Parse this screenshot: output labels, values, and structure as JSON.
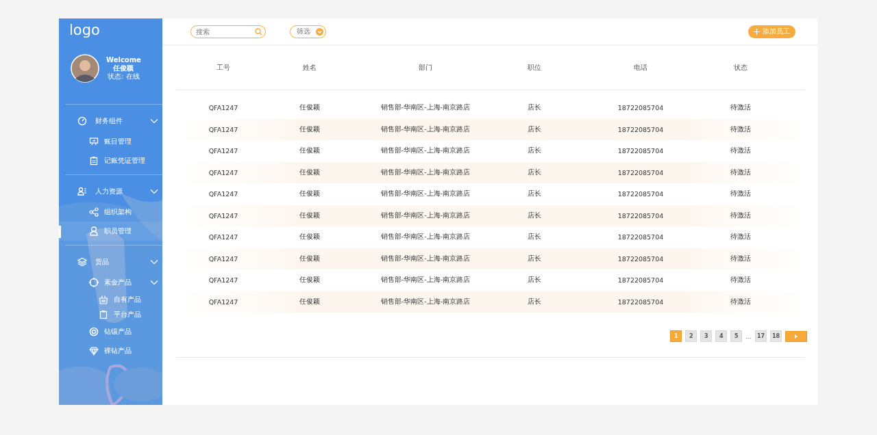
{
  "sidebar": {
    "logo": "logo",
    "profile": {
      "greeting": "Welcome",
      "name": "任俊颖",
      "status": "状态: 在线"
    },
    "groups": [
      {
        "label": "财务组件",
        "expanded": true,
        "children": [
          {
            "label": "账目管理",
            "selected": false
          },
          {
            "label": "记账凭证管理",
            "selected": false
          }
        ]
      },
      {
        "label": "人力资源",
        "expanded": true,
        "children": [
          {
            "label": "组织架构",
            "selected": false
          },
          {
            "label": "职员管理",
            "selected": true
          }
        ]
      },
      {
        "label": "货品",
        "expanded": true,
        "children": [
          {
            "label": "素金产品",
            "selected": false,
            "expanded": true,
            "children": [
              {
                "label": "自有产品",
                "selected": false
              },
              {
                "label": "平台产品",
                "selected": false
              }
            ]
          },
          {
            "label": "钻镶产品",
            "selected": false
          },
          {
            "label": "裸钻产品",
            "selected": false
          }
        ]
      }
    ]
  },
  "toolbar": {
    "search": {
      "placeholder": "搜索"
    },
    "filter": {
      "label": "筛选"
    },
    "add_button": {
      "label": "添加员工"
    }
  },
  "table": {
    "columns": [
      "工号",
      "姓名",
      "部门",
      "职位",
      "电话",
      "状态"
    ],
    "rows": [
      [
        "QFA1247",
        "任俊颖",
        "销售部-华南区-上海-南京路店",
        "店长",
        "18722085704",
        "待激活"
      ],
      [
        "QFA1247",
        "任俊颖",
        "销售部-华南区-上海-南京路店",
        "店长",
        "18722085704",
        "待激活"
      ],
      [
        "QFA1247",
        "任俊颖",
        "销售部-华南区-上海-南京路店",
        "店长",
        "18722085704",
        "待激活"
      ],
      [
        "QFA1247",
        "任俊颖",
        "销售部-华南区-上海-南京路店",
        "店长",
        "18722085704",
        "待激活"
      ],
      [
        "QFA1247",
        "任俊颖",
        "销售部-华南区-上海-南京路店",
        "店长",
        "18722085704",
        "待激活"
      ],
      [
        "QFA1247",
        "任俊颖",
        "销售部-华南区-上海-南京路店",
        "店长",
        "18722085704",
        "待激活"
      ],
      [
        "QFA1247",
        "任俊颖",
        "销售部-华南区-上海-南京路店",
        "店长",
        "18722085704",
        "待激活"
      ],
      [
        "QFA1247",
        "任俊颖",
        "销售部-华南区-上海-南京路店",
        "店长",
        "18722085704",
        "待激活"
      ],
      [
        "QFA1247",
        "任俊颖",
        "销售部-华南区-上海-南京路店",
        "店长",
        "18722085704",
        "待激活"
      ],
      [
        "QFA1247",
        "任俊颖",
        "销售部-华南区-上海-南京路店",
        "店长",
        "18722085704",
        "待激活"
      ]
    ]
  },
  "pagination": {
    "pages": [
      {
        "label": "1",
        "selected": true
      },
      {
        "label": "2",
        "selected": false
      },
      {
        "label": "3",
        "selected": false
      },
      {
        "label": "4",
        "selected": false
      },
      {
        "label": "5",
        "selected": false
      },
      {
        "label": "...",
        "kind": "gap"
      },
      {
        "label": "17",
        "selected": false
      },
      {
        "label": "18",
        "selected": false
      }
    ]
  }
}
